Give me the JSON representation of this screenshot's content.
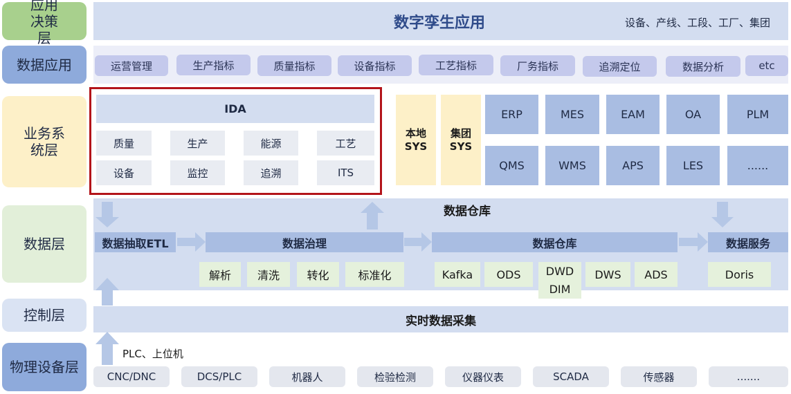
{
  "layers": {
    "app_decision": "应用决策层",
    "data_app": "数据应用",
    "business": "业务系统层",
    "data": "数据层",
    "control": "控制层",
    "physical": "物理设备层"
  },
  "top": {
    "title": "数字孪生应用",
    "subtitle": "设备、产线、工段、工厂、集团"
  },
  "data_app_items": [
    "运营管理",
    "生产指标",
    "质量指标",
    "设备指标",
    "工艺指标",
    "厂务指标",
    "追溯定位",
    "数据分析",
    "etc"
  ],
  "ida": {
    "title": "IDA",
    "modules": [
      "质量",
      "生产",
      "能源",
      "工艺",
      "设备",
      "监控",
      "追溯",
      "ITS"
    ]
  },
  "sys": {
    "local": [
      "本地",
      "SYS"
    ],
    "group": [
      "集团",
      "SYS"
    ]
  },
  "systems": [
    "ERP",
    "MES",
    "EAM",
    "OA",
    "PLM",
    "QMS",
    "WMS",
    "APS",
    "LES",
    "......"
  ],
  "data_layer": {
    "warehouse_title": "数据仓库",
    "etl": "数据抽取ETL",
    "governance": "数据治理",
    "warehouse": "数据仓库",
    "service": "数据服务",
    "governance_items": [
      "解析",
      "清洗",
      "转化",
      "标准化"
    ],
    "warehouse_items": [
      "Kafka",
      "ODS",
      "DWD",
      "DIM",
      "DWS",
      "ADS"
    ],
    "service_items": [
      "Doris"
    ]
  },
  "control": {
    "title": "实时数据采集"
  },
  "physical": {
    "link_label": "PLC、上位机",
    "devices": [
      "CNC/DNC",
      "DCS/PLC",
      "机器人",
      "检验检测",
      "仪器仪表",
      "SCADA",
      "传感器",
      "......."
    ]
  },
  "colors": {
    "band": "#d3ddf0",
    "pill": "#c4c9ec",
    "system_box": "#a9bde2",
    "yellow": "#fdf0c8",
    "green": "#e5f1dc",
    "highlight_border": "#b3141a",
    "arrow": "#b5c7e6"
  }
}
